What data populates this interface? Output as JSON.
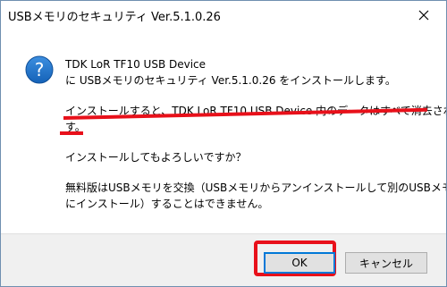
{
  "window": {
    "title": "USBメモリのセキュリティ Ver.5.1.0.26"
  },
  "dialog": {
    "icon": "question-icon",
    "line1": "TDK LoR TF10 USB Device",
    "line2": "に USBメモリのセキュリティ Ver.5.1.0.26 をインストールします。",
    "warning_line1": "インストールすると、TDK LoR TF10 USB Device 内のデータはすべて消去されま",
    "warning_line2": "す。",
    "question": "インストールしてもよろしいですか？",
    "note_line1": "無料版はUSBメモリを交換（USBメモリからアンインストールして別のUSBメモリ",
    "note_line2": "にインストール）することはできません。"
  },
  "buttons": {
    "ok": "OK",
    "cancel": "キャンセル"
  },
  "colors": {
    "highlight": "#e8101a",
    "icon_blue": "#1a73c8",
    "focus_border": "#0078d7"
  }
}
